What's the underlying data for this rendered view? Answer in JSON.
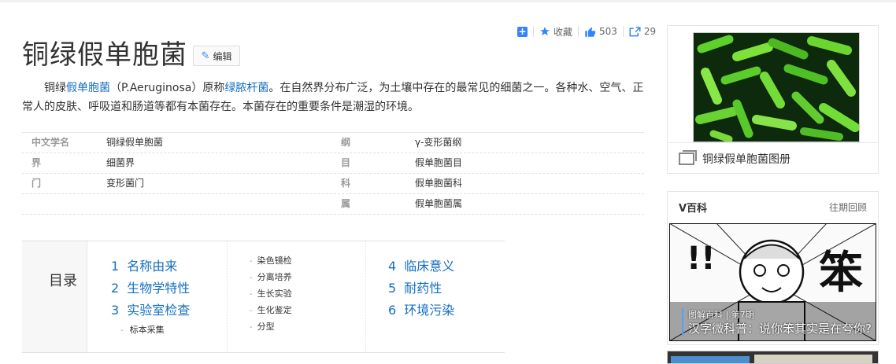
{
  "actions": {
    "like_count": "503",
    "favorite_label": "收藏",
    "share_count": "29"
  },
  "title": "铜绿假单胞菌",
  "edit_label": "编辑",
  "summary": {
    "p1": "铜绿",
    "link1": "假单胞菌",
    "p2": "（P.Aeruginosa）原称",
    "link2": "绿脓杆菌",
    "p3": "。在自然界分布广泛，为土壤中存在的最常见的细菌之一。各种水、空气、正常人的皮肤、呼吸道和肠道等都有本菌存在。本菌存在的重要条件是潮湿的环境。"
  },
  "basic_info": [
    {
      "k1": "中文学名",
      "v1": "铜绿假单胞菌",
      "k2": "纲",
      "v2": "γ-变形菌纲"
    },
    {
      "k1": "界",
      "v1": "细菌界",
      "k2": "目",
      "v2": "假单胞菌目"
    },
    {
      "k1": "门",
      "v1": "变形菌门",
      "k2": "科",
      "v2": "假单胞菌科"
    },
    {
      "k1": "",
      "v1": "",
      "k2": "属",
      "v2": "假单胞菌属"
    }
  ],
  "toc": {
    "heading": "目录",
    "col1": [
      {
        "num": "1",
        "label": "名称由来"
      },
      {
        "num": "2",
        "label": "生物学特性"
      },
      {
        "num": "3",
        "label": "实验室检查"
      }
    ],
    "col1_sub": [
      "标本采集"
    ],
    "col2_sub": [
      "染色镜检",
      "分离培养",
      "生长实验",
      "生化鉴定",
      "分型"
    ],
    "col3": [
      {
        "num": "4",
        "label": "临床意义"
      },
      {
        "num": "5",
        "label": "耐药性"
      },
      {
        "num": "6",
        "label": "环境污染"
      }
    ]
  },
  "album": {
    "caption": "铜绿假单胞菌图册"
  },
  "vbaike": {
    "title": "V百科",
    "more": "往期回顾",
    "meta": "图解百科 | 第7期",
    "comic_title": "汉字微科普：说你笨其实是在夸你?",
    "comic_big_char": "笨",
    "comic_exclaim": "!!"
  },
  "colors": {
    "link": "#136ec2",
    "accent": "#3385ff"
  }
}
